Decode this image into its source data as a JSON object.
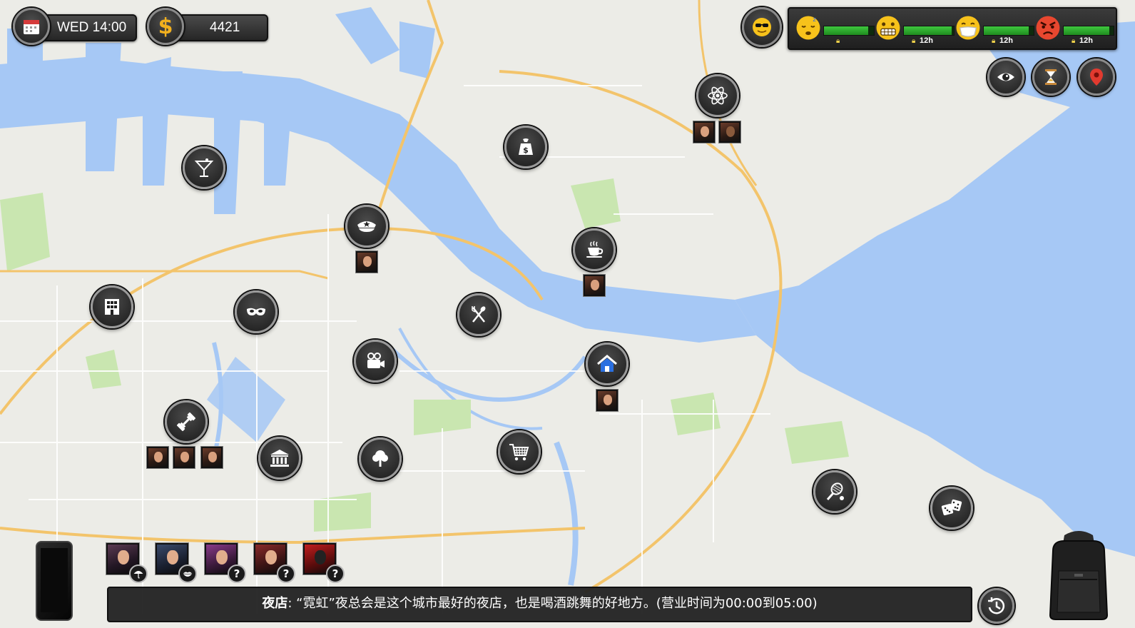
{
  "hud": {
    "day_time": "WED 14:00",
    "money": "4421",
    "money_symbol": "$"
  },
  "stats": [
    {
      "name": "sleepy-face",
      "fill": 0.88,
      "value": ""
    },
    {
      "name": "grimace-face",
      "fill": 0.95,
      "value": "12h"
    },
    {
      "name": "mask-face",
      "fill": 0.9,
      "value": "12h"
    },
    {
      "name": "angry-face",
      "fill": 0.92,
      "value": "12h"
    }
  ],
  "mood_icon": "sunglasses-face-icon",
  "top_right_buttons": [
    "eye-icon",
    "hourglass-icon",
    "map-pin-icon"
  ],
  "locations": [
    {
      "name": "nightclub",
      "icon": "cocktail-icon"
    },
    {
      "name": "police-station",
      "icon": "police-cap-icon",
      "people": 1
    },
    {
      "name": "shopping",
      "icon": "money-bag-icon"
    },
    {
      "name": "science-lab",
      "icon": "atom-icon",
      "people": 2
    },
    {
      "name": "cafe",
      "icon": "coffee-cup-icon",
      "people": 1
    },
    {
      "name": "apartments",
      "icon": "building-icon"
    },
    {
      "name": "masquerade",
      "icon": "mask-icon"
    },
    {
      "name": "restaurant",
      "icon": "fork-knife-icon"
    },
    {
      "name": "cinema",
      "icon": "video-camera-icon"
    },
    {
      "name": "home",
      "icon": "home-icon",
      "people": 1
    },
    {
      "name": "gym",
      "icon": "dumbbell-icon",
      "people": 3
    },
    {
      "name": "bank",
      "icon": "bank-icon"
    },
    {
      "name": "park",
      "icon": "tree-icon"
    },
    {
      "name": "supermarket",
      "icon": "shopping-cart-icon"
    },
    {
      "name": "tennis-club",
      "icon": "tennis-racket-icon"
    },
    {
      "name": "casino",
      "icon": "dice-icon"
    }
  ],
  "contacts": [
    {
      "badge": "icon",
      "badge_icon": "umbrella-icon"
    },
    {
      "badge": "icon",
      "badge_icon": "lips-icon"
    },
    {
      "badge": "?"
    },
    {
      "badge": "?"
    },
    {
      "badge": "?"
    }
  ],
  "description": {
    "title": "夜店",
    "text": ": “霓虹”夜总会是这个城市最好的夜店，也是喝酒跳舞的好地方。(营业时间为00:00到05:00)"
  },
  "colors": {
    "water": "#a6c8f5",
    "land": "#ecece7",
    "park": "#c9e6b0",
    "road_major": "#f3c46b",
    "bar_green": "#2fb52f"
  }
}
